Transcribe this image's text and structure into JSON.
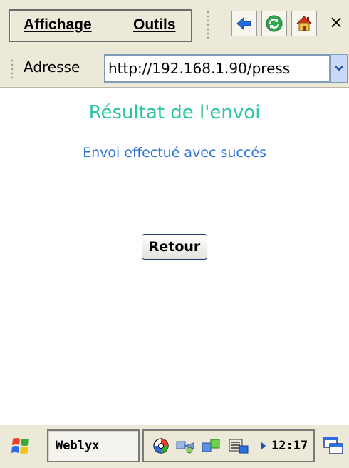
{
  "menu": {
    "view_label": "Affichage",
    "tools_label": "Outils"
  },
  "toolbar": {
    "back_icon": "back-arrow-icon",
    "refresh_icon": "refresh-icon",
    "home_icon": "home-icon",
    "close_label": "×"
  },
  "address": {
    "label": "Adresse",
    "value": "http://192.168.1.90/press"
  },
  "content": {
    "title": "Résultat de l'envoi",
    "message": "Envoi effectué avec succés",
    "back_button_label": "Retour"
  },
  "taskbar": {
    "app_label": "Weblyx",
    "clock": "12:17"
  },
  "colors": {
    "title": "#2cc5a4",
    "message": "#2f73d8",
    "chrome": "#ece9d8"
  }
}
